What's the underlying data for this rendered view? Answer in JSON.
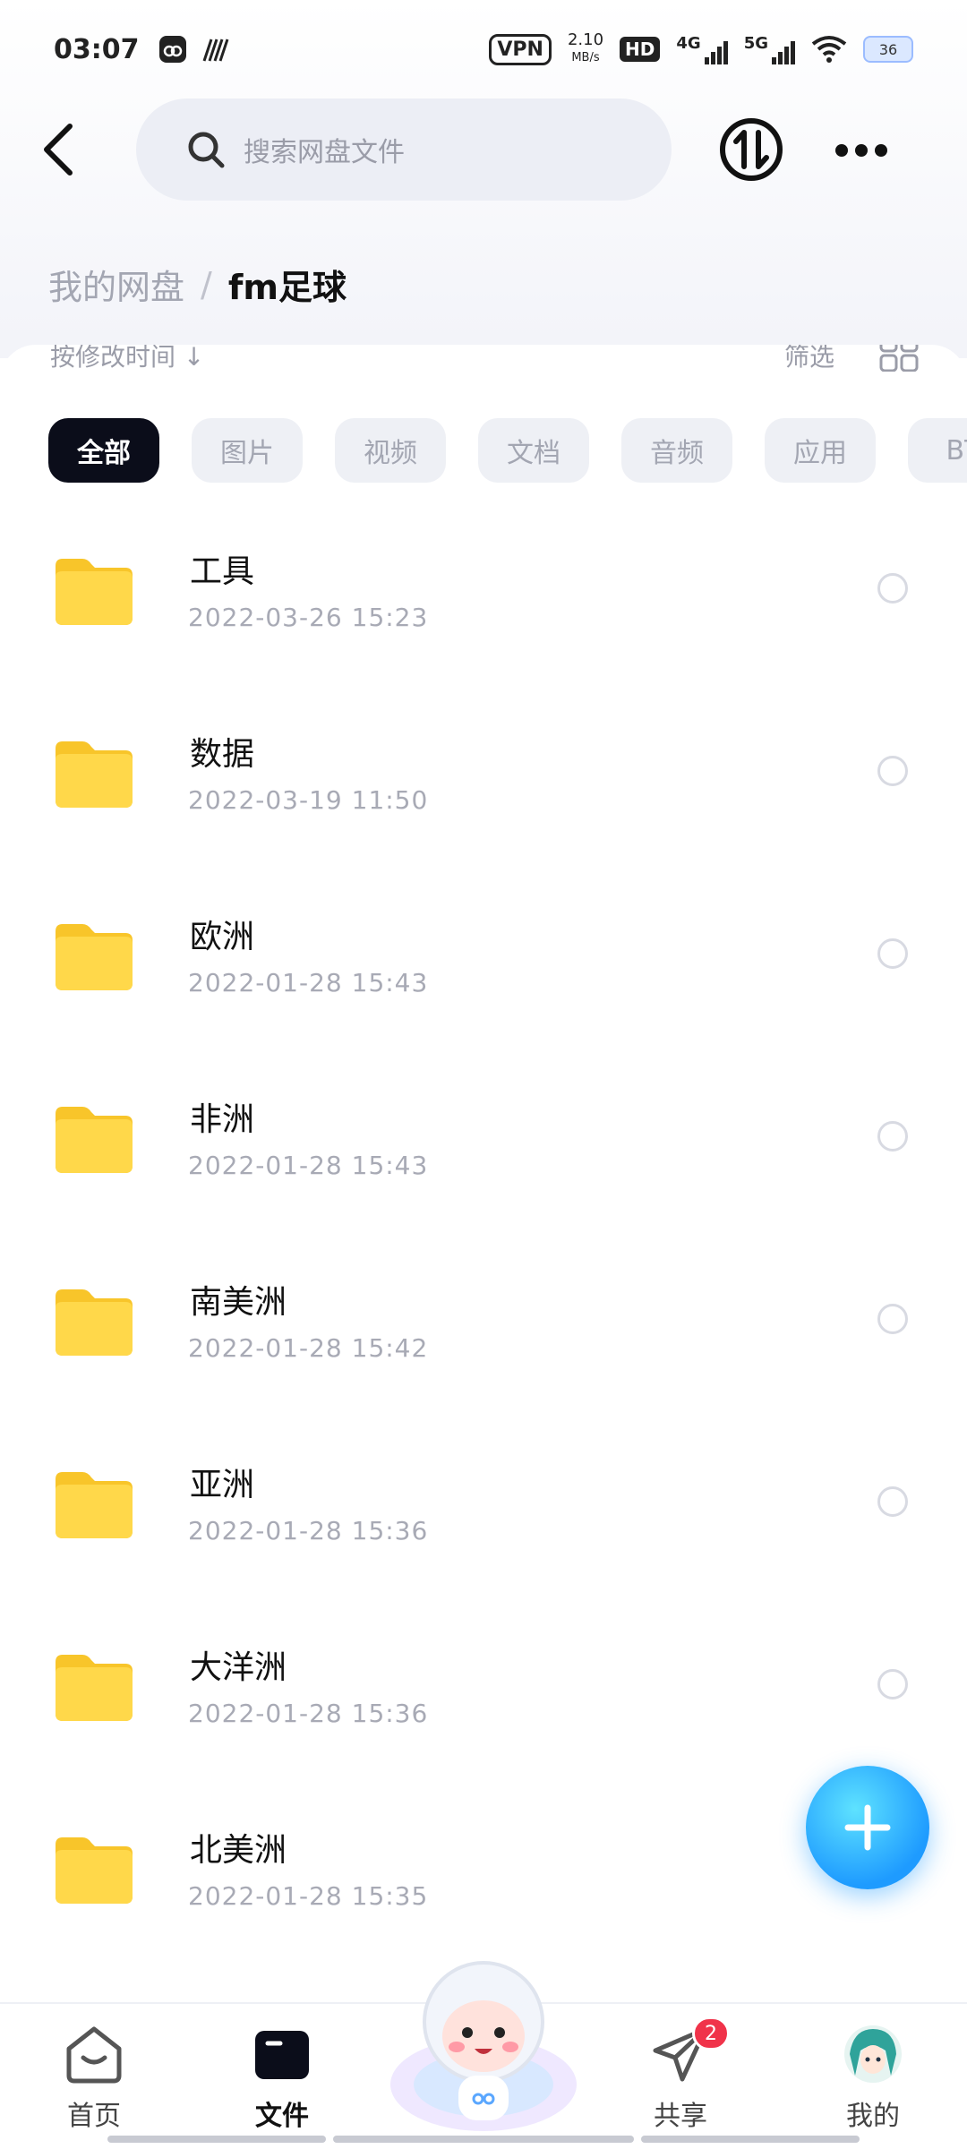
{
  "status_bar": {
    "time": "03:07",
    "vpn": "VPN",
    "speed_value": "2.10",
    "speed_unit": "MB/s",
    "hd": "HD",
    "net_4g": "4G",
    "net_5g": "5G",
    "battery": "36"
  },
  "header": {
    "search_placeholder": "搜索网盘文件"
  },
  "breadcrumb": {
    "root": "我的网盘",
    "separator": "/",
    "current": "fm足球"
  },
  "toolbar": {
    "sort_label": "按修改时间 ↓",
    "filter_label": "筛选"
  },
  "filter_chips": [
    "全部",
    "图片",
    "视频",
    "文档",
    "音频",
    "应用",
    "BT"
  ],
  "files": [
    {
      "name": "工具",
      "date": "2022-03-26  15:23"
    },
    {
      "name": "数据",
      "date": "2022-03-19  11:50"
    },
    {
      "name": "欧洲",
      "date": "2022-01-28  15:43"
    },
    {
      "name": "非洲",
      "date": "2022-01-28  15:43"
    },
    {
      "name": "南美洲",
      "date": "2022-01-28  15:42"
    },
    {
      "name": "亚洲",
      "date": "2022-01-28  15:36"
    },
    {
      "name": "大洋洲",
      "date": "2022-01-28  15:36"
    },
    {
      "name": "北美洲",
      "date": "2022-01-28  15:35"
    }
  ],
  "bottom_nav": {
    "home": "首页",
    "files": "文件",
    "share": "共享",
    "share_badge": "2",
    "mine": "我的"
  },
  "colors": {
    "folder": "#FFD23F",
    "accent_fab": "#1E9BFF",
    "chip_active": "#0B0D1A",
    "badge": "#F0334A"
  }
}
